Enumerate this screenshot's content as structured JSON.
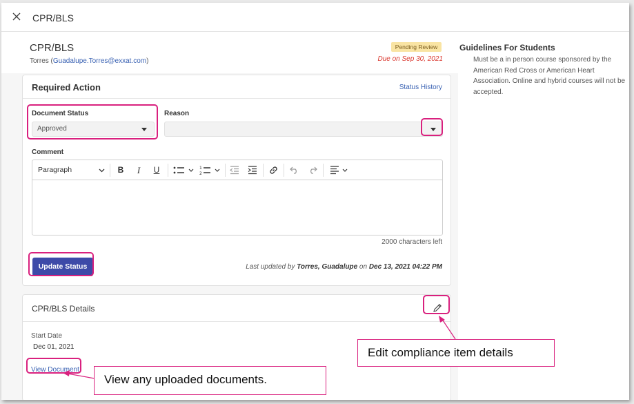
{
  "topbar": {
    "title": "CPR/BLS"
  },
  "header": {
    "item_title": "CPR/BLS",
    "user_name": "Torres (",
    "user_email": "Guadalupe.Torres@exxat.com",
    "user_close": ")",
    "badge": "Pending Review",
    "due": "Due on Sep 30, 2021"
  },
  "required_action": {
    "title": "Required Action",
    "status_history": "Status History",
    "document_status_label": "Document Status",
    "document_status_value": "Approved",
    "reason_label": "Reason",
    "reason_value": "",
    "comment_label": "Comment",
    "toolbar": {
      "paragraph": "Paragraph",
      "bold": "B",
      "italic": "I",
      "underline": "U"
    },
    "chars_left": "2000 characters left",
    "update_button": "Update Status",
    "last_updated_prefix": "Last updated by ",
    "last_updated_user": "Torres, Guadalupe",
    "last_updated_mid": " on ",
    "last_updated_time": "Dec 13, 2021 04:22 PM"
  },
  "details": {
    "title": "CPR/BLS Details",
    "start_date_label": "Start Date",
    "start_date_value": "Dec 01, 2021",
    "view_document": "View Document"
  },
  "guidelines": {
    "title": "Guidelines For Students",
    "text": "Must be a in person course sponsored by the American Red Cross or American Heart Association. Online and hybrid courses will not be accepted."
  },
  "callouts": {
    "edit": "Edit compliance item details",
    "view": "View any uploaded documents."
  },
  "colors": {
    "accent": "#3d4aa8",
    "highlight": "#d9207e",
    "link": "#3a62b3",
    "due": "#d9342b",
    "badge_bg": "#f9e4a3"
  }
}
